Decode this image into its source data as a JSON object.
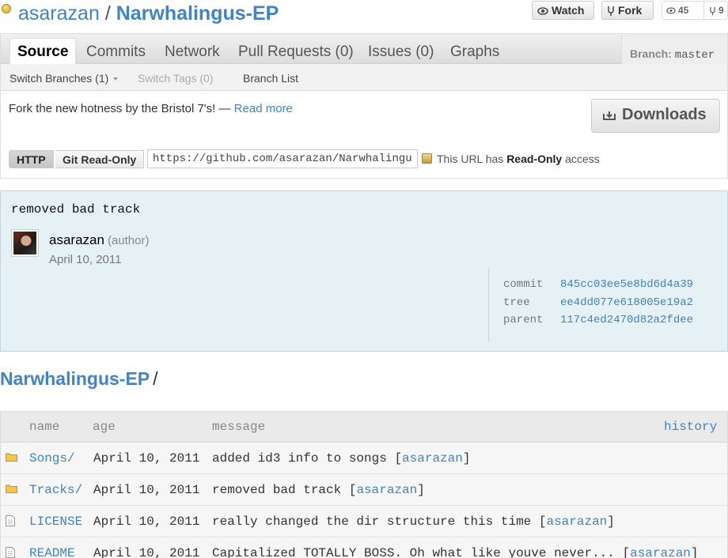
{
  "header": {
    "owner": "asarazan",
    "separator": "/",
    "repo_name": "Narwhalingus-EP",
    "watch_label": "Watch",
    "fork_label": "Fork",
    "watchers_count": "45",
    "forks_count": "9"
  },
  "tabs": [
    {
      "label": "Source",
      "selected": true
    },
    {
      "label": "Commits"
    },
    {
      "label": "Network"
    },
    {
      "label": "Pull Requests (0)"
    },
    {
      "label": "Issues (0)"
    },
    {
      "label": "Graphs"
    }
  ],
  "branch": {
    "label": "Branch:",
    "value": "master"
  },
  "subnav": {
    "switch_branches": "Switch Branches (1)",
    "switch_tags": "Switch Tags (0)",
    "branch_list": "Branch List"
  },
  "description": {
    "text": "Fork the new hotness by the Bristol 7's! —",
    "read_more": "Read more"
  },
  "downloads_label": "Downloads",
  "clone": {
    "http_label": "HTTP",
    "git_label": "Git Read-Only",
    "url": "https://github.com/asarazan/Narwhalingus-EP.git",
    "note_prefix": "This URL has",
    "note_bold": "Read-Only",
    "note_suffix": "access"
  },
  "commit": {
    "message": "removed bad track",
    "author": "asarazan",
    "author_role": "(author)",
    "date": "April 10, 2011",
    "commit_label": "commit",
    "commit_sha": "845cc03ee5e8bd6d4a39",
    "tree_label": "tree",
    "tree_sha": "ee4dd077e618005e19a2",
    "parent_label": "parent",
    "parent_sha": "117c4ed2470d82a2fdee"
  },
  "breadcrumb": {
    "repo": "Narwhalingus-EP",
    "slash": "/"
  },
  "tree": {
    "headers": {
      "name": "name",
      "age": "age",
      "message": "message",
      "history": "history"
    },
    "rows": [
      {
        "type": "folder",
        "name": "Songs/",
        "age": "April 10, 2011",
        "message": "added id3 info to songs [",
        "author": "asarazan",
        "close": "]"
      },
      {
        "type": "folder",
        "name": "Tracks/",
        "age": "April 10, 2011",
        "message": "removed bad track [",
        "author": "asarazan",
        "close": "]"
      },
      {
        "type": "file",
        "name": "LICENSE",
        "age": "April 10, 2011",
        "message": "really changed the dir structure this time [",
        "author": "asarazan",
        "close": "]"
      },
      {
        "type": "file",
        "name": "README",
        "age": "April 10, 2011",
        "message": "Capitalized TOTALLY BOSS. Oh what like youve never... [",
        "author": "asarazan",
        "close": "]"
      }
    ]
  }
}
